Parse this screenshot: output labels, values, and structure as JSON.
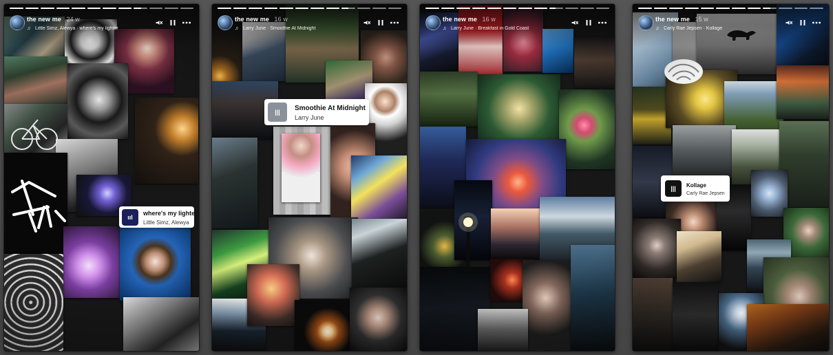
{
  "stories": [
    {
      "username": "the new me",
      "age": "24 w",
      "song_line": "Little Simz, Alewya · where's my lighter",
      "sticker_title": "where's my lighter",
      "sticker_artist": "Little Simz, Alewya",
      "progress": [
        1,
        1,
        1,
        1,
        1,
        1,
        1,
        1,
        0.55,
        0,
        0,
        0
      ]
    },
    {
      "username": "the new me",
      "age": "16 w",
      "song_line": "Larry June · Smoothie At Midnight",
      "sticker_title": "Smoothie At Midnight",
      "sticker_artist": "Larry June",
      "progress": [
        1,
        1,
        1,
        1,
        1,
        1,
        1,
        1,
        0.5,
        0,
        0,
        0
      ]
    },
    {
      "username": "the new me",
      "age": "16 w",
      "song_line": "Larry June · Breakfast in Gold Coast",
      "sticker_title": "",
      "sticker_artist": "",
      "progress": [
        1,
        1,
        1,
        1,
        1,
        1,
        1,
        1,
        0.45,
        0,
        0,
        0
      ]
    },
    {
      "username": "the new me",
      "age": "15 w",
      "song_line": "Carly Rae Jepsen · Kollage",
      "sticker_title": "Kollage",
      "sticker_artist": "Carly Rae Jepsen",
      "progress": [
        1,
        1,
        1,
        1,
        1,
        1,
        1,
        1,
        0.55,
        0,
        0,
        0
      ]
    }
  ],
  "icons": {
    "music": "music-note-icon",
    "mute": "volume-mute-icon",
    "pause": "pause-icon",
    "more": "more-icon",
    "sticker_art": "album-art-icon"
  },
  "colors": {
    "background": "#4b4b4b",
    "panel": "#171717",
    "text": "#ffffff",
    "sticker": "#ffffff"
  }
}
